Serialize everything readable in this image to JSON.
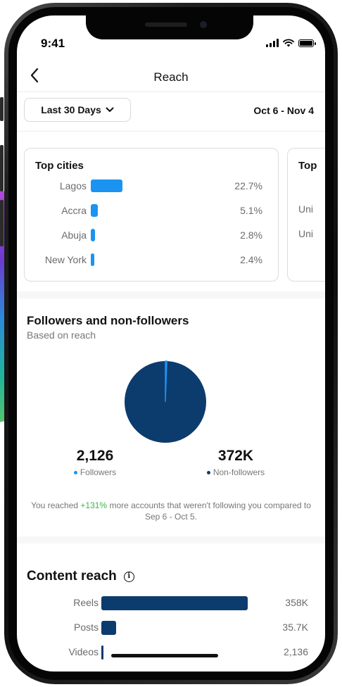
{
  "status_bar": {
    "time": "9:41"
  },
  "nav": {
    "title": "Reach"
  },
  "filter": {
    "range_label": "Last 30 Days",
    "date_range": "Oct 6 - Nov 4"
  },
  "top_cities": {
    "title": "Top cities",
    "rows": [
      {
        "city": "Lagos",
        "percent_label": "22.7%",
        "percent": 22.7
      },
      {
        "city": "Accra",
        "percent_label": "5.1%",
        "percent": 5.1
      },
      {
        "city": "Abuja",
        "percent_label": "2.8%",
        "percent": 2.8
      },
      {
        "city": "New York",
        "percent_label": "2.4%",
        "percent": 2.4
      }
    ]
  },
  "next_card": {
    "title_partial": "Top",
    "rows_partial": [
      "Uni",
      "Uni"
    ]
  },
  "followers": {
    "title": "Followers and non-followers",
    "subtitle": "Based on reach",
    "followers_value": "2,126",
    "followers_label": "Followers",
    "non_followers_value": "372K",
    "non_followers_label": "Non-followers",
    "followers_count": 2126,
    "non_followers_count": 372000,
    "note_prefix": "You reached ",
    "note_highlight": "+131%",
    "note_suffix": " more accounts that weren't following you compared to Sep 6 - Oct 5."
  },
  "content_reach": {
    "title": "Content reach",
    "rows": [
      {
        "label": "Reels",
        "value_label": "358K",
        "value": 358000
      },
      {
        "label": "Posts",
        "value_label": "35.7K",
        "value": 35700
      },
      {
        "label": "Videos",
        "value_label": "2,136",
        "value": 2136
      }
    ]
  },
  "colors": {
    "city_bar": "#1a94f0",
    "followers": "#1a94f0",
    "non_followers": "#0c3b6e",
    "content_bar": "#0c3b6e",
    "positive": "#3cb54a"
  },
  "icons": [
    "back-chevron-icon",
    "chevron-down-icon",
    "info-icon",
    "signal-icon",
    "wifi-icon",
    "battery-icon"
  ]
}
